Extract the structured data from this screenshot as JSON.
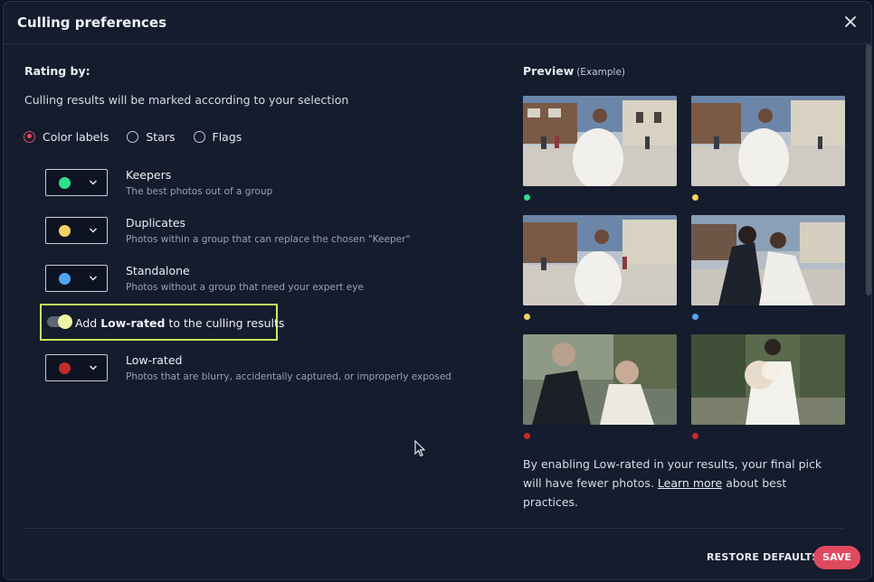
{
  "dialog": {
    "title": "Culling preferences",
    "close_icon": "close-icon"
  },
  "rating": {
    "section_title": "Rating by:",
    "description": "Culling results will be marked according to your selection",
    "options": [
      "Color labels",
      "Stars",
      "Flags"
    ],
    "selected": "Color labels"
  },
  "labels": [
    {
      "name": "Keepers",
      "description": "The best photos out of a group",
      "color": "#2ee08b"
    },
    {
      "name": "Duplicates",
      "description": "Photos within a group that can replace the chosen \"Keeper\"",
      "color": "#f4d060"
    },
    {
      "name": "Standalone",
      "description": "Photos without a group that need your expert eye",
      "color": "#4fa7f5"
    },
    {
      "name": "Low-rated",
      "description": "Photos that are blurry, accidentally captured, or improperly exposed",
      "color": "#c62b2b"
    }
  ],
  "toggle": {
    "prefix": "Add",
    "bold": "Low-rated",
    "suffix": "to the culling results",
    "enabled": true
  },
  "preview": {
    "title": "Preview",
    "subtitle": "(Example)",
    "thumbnails": [
      {
        "image": "bride-town-square",
        "label_color": "#2ee08b"
      },
      {
        "image": "bride-town-square-alt",
        "label_color": "#f4d060"
      },
      {
        "image": "bride-town-square-2",
        "label_color": "#f4d060"
      },
      {
        "image": "couple-kiss",
        "label_color": "#4fa7f5"
      },
      {
        "image": "couple-blurry",
        "label_color": "#c62b2b"
      },
      {
        "image": "bride-bouquet",
        "label_color": "#c62b2b"
      }
    ],
    "note_prefix": "By enabling Low-rated in your results, your final pick will have fewer photos.",
    "note_link": "Learn more",
    "note_suffix": "about best practices."
  },
  "footer": {
    "restore_label": "RESTORE DEFAULTS",
    "save_label": "SAVE"
  }
}
